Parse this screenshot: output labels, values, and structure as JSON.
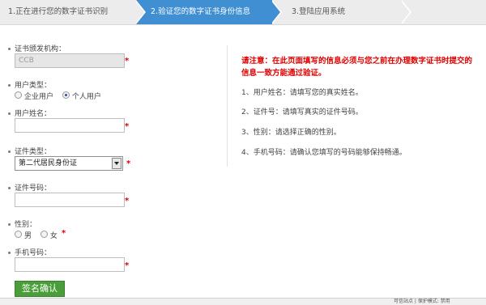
{
  "steps": [
    {
      "label": "1.正在进行您的数字证书识别"
    },
    {
      "label": "2.验证您的数字证书身份信息"
    },
    {
      "label": "3.登陆应用系统"
    }
  ],
  "form": {
    "issuer_label": "证书颁发机构：",
    "issuer_value": "CCB",
    "user_type_label": "用户类型：",
    "user_type_options": [
      "企业用户",
      "个人用户"
    ],
    "user_type_selected": "个人用户",
    "user_name_label": "用户姓名：",
    "user_name_value": "",
    "cert_type_label": "证件类型：",
    "cert_type_value": "第二代居民身份证",
    "cert_no_label": "证件号码：",
    "cert_no_value": "",
    "gender_label": "性别：",
    "gender_options": [
      "男",
      "女"
    ],
    "phone_label": "手机号码：",
    "phone_value": "",
    "required_mark": "*",
    "submit_label": "签名确认"
  },
  "notice": {
    "title": "请注意：在此页面填写的信息必须与您之前在办理数字证书时提交的信息一致方能通过验证。",
    "items": [
      "1、用户姓名：请填写您的真实姓名。",
      "2、证件号：请填写真实的证件号码。",
      "3、性别：请选择正确的性别。",
      "4、手机号码：请确认您填写的号码能够保持畅通。"
    ]
  },
  "statusbar": {
    "text": "可信站点 | 保护模式: 禁用"
  },
  "colors": {
    "active_step": "#3f8fd2",
    "required": "#e00000",
    "submit": "#4a9e3a"
  }
}
